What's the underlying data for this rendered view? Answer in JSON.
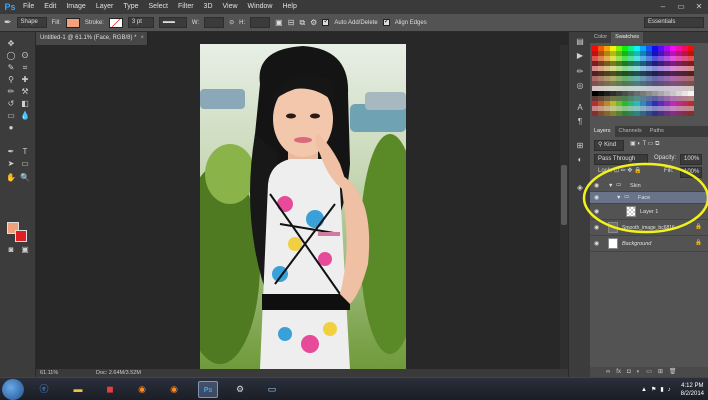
{
  "app": {
    "logo": "Ps"
  },
  "menu": [
    "File",
    "Edit",
    "Image",
    "Layer",
    "Type",
    "Select",
    "Filter",
    "3D",
    "View",
    "Window",
    "Help"
  ],
  "window_controls": [
    "–",
    "▭",
    "✕"
  ],
  "options": {
    "shape_mode": "Shape",
    "fill_label": "Fill:",
    "fill_color": "#f4a27c",
    "stroke_label": "Stroke:",
    "stroke_width": "3 pt",
    "w_label": "W:",
    "h_label": "H:",
    "auto_add_delete": "Auto Add/Delete",
    "align_edges": "Align Edges",
    "workspace": "Essentials"
  },
  "document": {
    "tab_title": "Untitled-1 @ 61.1% (Face, RGB/8) *",
    "tab_close": "×",
    "zoom": "61.11%",
    "doc_info": "Doc: 2.64M/3.52M"
  },
  "colors": {
    "foreground": "#f0a07a",
    "background": "#e02020"
  },
  "panels": {
    "color_tabs": [
      "Color",
      "Swatches"
    ],
    "layer_tabs": [
      "Layers",
      "Channels",
      "Paths"
    ],
    "kind_label": "Kind",
    "blend_mode": "Pass Through",
    "opacity_label": "Opacity:",
    "opacity_value": "100%",
    "fill_label": "Fill:",
    "fill_value": "100%"
  },
  "layers": [
    {
      "name": "Skin",
      "type": "group",
      "indent": 0
    },
    {
      "name": "Face",
      "type": "group",
      "indent": 1,
      "selected": true
    },
    {
      "name": "Layer 1",
      "type": "layer",
      "indent": 2
    },
    {
      "name": "Smooth_image_bc6816...",
      "type": "image",
      "indent": 0
    },
    {
      "name": "Background",
      "type": "background",
      "indent": 0
    }
  ],
  "taskbar": {
    "apps": [
      "ie",
      "explorer",
      "media",
      "firefox",
      "firefox",
      "photoshop",
      "tools",
      "monitor"
    ],
    "time": "4:12 PM",
    "date": "8/2/2014"
  }
}
